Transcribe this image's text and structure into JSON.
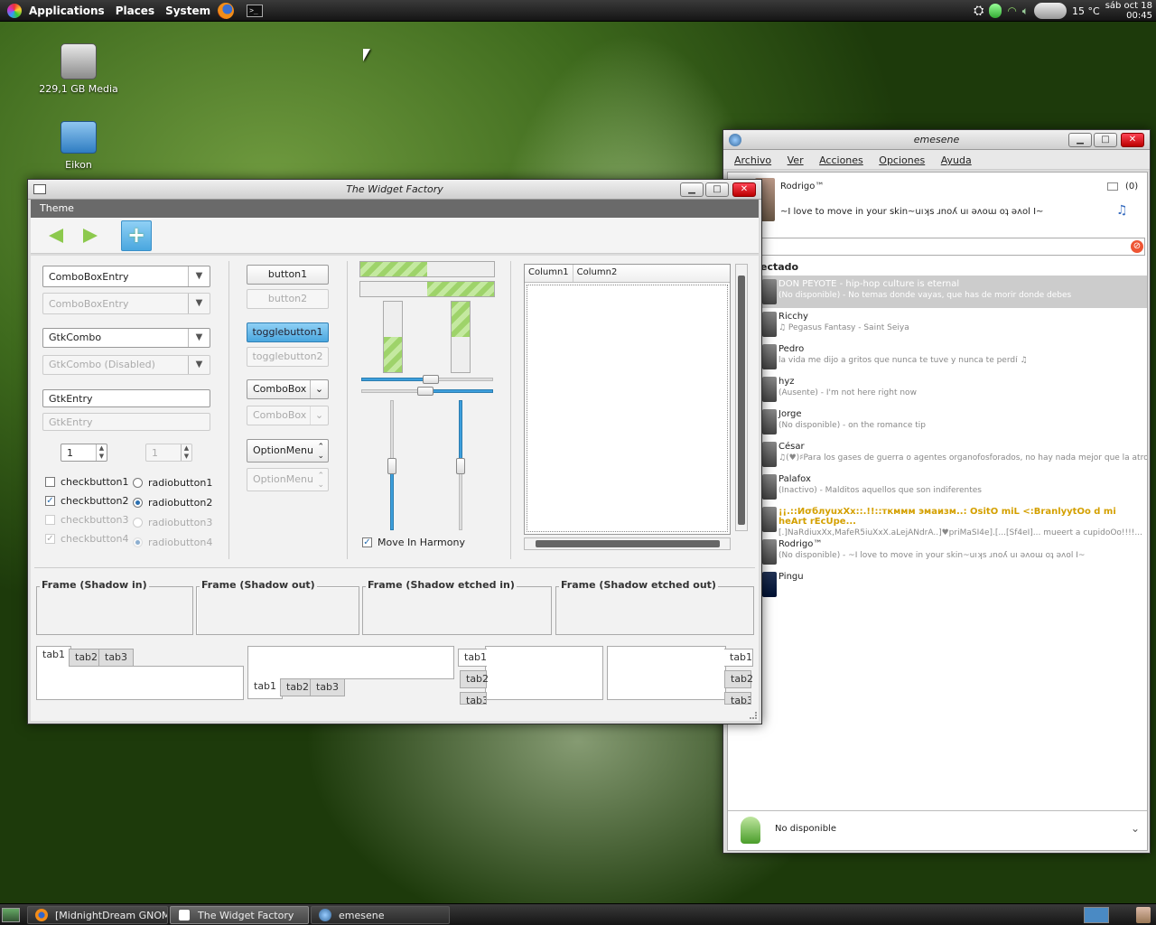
{
  "top_panel": {
    "menus": [
      "Applications",
      "Places",
      "System"
    ],
    "weather_temp": "15 °C",
    "clock_date": "sáb oct 18",
    "clock_time": "00:45"
  },
  "desktop": {
    "icons": [
      {
        "label": "229,1 GB Media",
        "icon": "hard-drive-icon"
      },
      {
        "label": "Eikon",
        "icon": "folder-icon"
      }
    ]
  },
  "widget_factory": {
    "title": "The Widget Factory",
    "menu": "Theme",
    "combos": {
      "cbe1": "ComboBoxEntry",
      "cbe2": "ComboBoxEntry",
      "gtkcombo": "GtkCombo",
      "gtkcombo_dis": "GtkCombo (Disabled)",
      "entry1": "GtkEntry",
      "entry2": "GtkEntry",
      "spin1": "1",
      "spin2": "1"
    },
    "checks": [
      "checkbutton1",
      "checkbutton2",
      "checkbutton3",
      "checkbutton4"
    ],
    "radios": [
      "radiobutton1",
      "radiobutton2",
      "radiobutton3",
      "radiobutton4"
    ],
    "buttons": {
      "b1": "button1",
      "b2": "button2",
      "t1": "togglebutton1",
      "t2": "togglebutton2",
      "combo1": "ComboBox",
      "combo2": "ComboBox",
      "opt1": "OptionMenu",
      "opt2": "OptionMenu"
    },
    "progress": {
      "h1": 0.5,
      "h2": 0.5,
      "v1": 0.5,
      "v2": 0.5
    },
    "move_in_harmony": "Move In Harmony",
    "tree": {
      "columns": [
        "Column1",
        "Column2"
      ]
    },
    "frames": [
      "Frame (Shadow in)",
      "Frame (Shadow out)",
      "Frame (Shadow etched in)",
      "Frame (Shadow etched out)"
    ],
    "tabs": [
      "tab1",
      "tab2",
      "tab3"
    ]
  },
  "emesene": {
    "title": "emesene",
    "menu": [
      "Archivo",
      "Ver",
      "Acciones",
      "Opciones",
      "Ayuda"
    ],
    "user_name": "Rodrigo™",
    "mail_count": "(0)",
    "user_message": "~I love to move in your skin~uıʞs ɹnoʎ uı ǝʌoɯ oʇ ǝʌol I~",
    "group": "ectado",
    "contacts": [
      {
        "name": "DON PEYOTE - hip-hop culture is eternal",
        "status": "(No disponible) - No temas donde vayas, que has de morir donde debes"
      },
      {
        "name": "Ricchy",
        "status": "♫ Pegasus Fantasy - Saint Seiya"
      },
      {
        "name": "Pedro",
        "status": "la vida me dijo a gritos que nunca te tuve y nunca te perdí ♫"
      },
      {
        "name": "hyz",
        "status": "(Ausente) - I'm not here right now"
      },
      {
        "name": "Jorge",
        "status": "(No disponible) - on the romance tip"
      },
      {
        "name": "César",
        "status": "♫(♥)♯Para los gases de guerra o agentes organofosforados, no hay nada mejor que la atropina y la prali..."
      },
      {
        "name": "Palafox",
        "status": "(Inactivo) - Malditos aquellos que son indiferentes"
      },
      {
        "name": "¡¡.::ИσблуuxXx::.!!::ткммм эмаизм..: OsitO miL <:BranlyytOo d mi heArt rEcUpe...",
        "status": "[.]NaRdiuxXx,MafeR5iuXxX.aLejANdrA..]♥priMaSI4e].[...[Sf4eI]... mueert a cupidoOo!!!!..."
      },
      {
        "name": "Rodrigo™",
        "status": "(No disponible) - ~I love to move in your skin~uıʞs ɹnoʎ uı ǝʌoɯ oʇ ǝʌol I~"
      },
      {
        "name": "Pingu",
        "status": ""
      }
    ],
    "status_select": "No disponible"
  },
  "taskbar": {
    "tasks": [
      "[MidnightDream GNOM...",
      "The Widget Factory",
      "emesene"
    ]
  }
}
